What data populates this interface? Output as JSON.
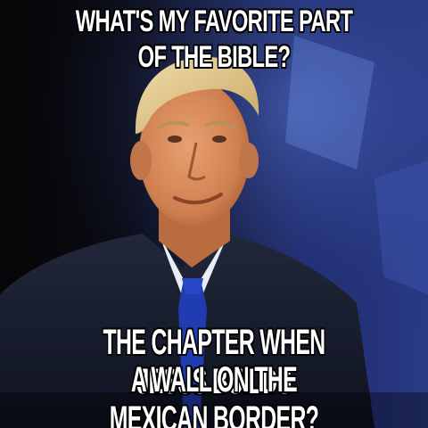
{
  "meme": {
    "top_text": "WHAT'S MY FAVORITE PART OF THE BIBLE?",
    "bottom_text_lines": [
      "THE CHAPTER WHEN JESUS BUILDS",
      "A WALL ON THE MEXICAN BORDER?"
    ]
  },
  "colors": {
    "caption_fill": "#ffffff",
    "caption_outline": "#000000",
    "backdrop_blue": "#2a3a86",
    "suit": "#141a28",
    "tie": "#1f3cb0",
    "skin": "#d98b5e",
    "hair": "#e2c98e"
  }
}
